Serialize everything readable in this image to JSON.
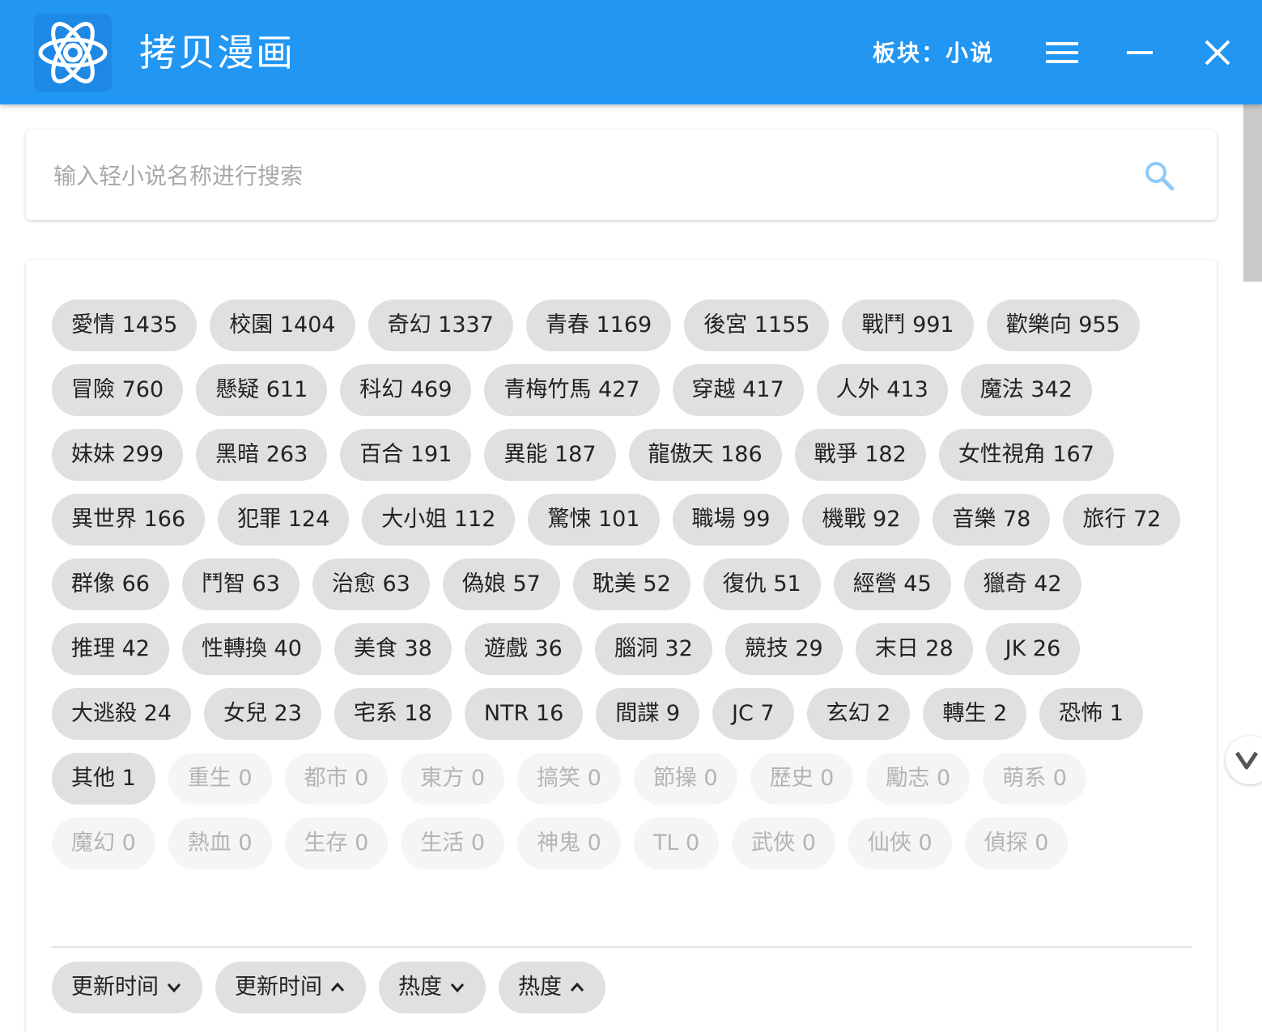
{
  "app": {
    "title": "拷贝漫画",
    "board_label": "板块：小说"
  },
  "colors": {
    "titlebar": "#2196f3",
    "chip_active_bg": "#e0e0e0",
    "chip_empty_bg": "#f5f5f5",
    "chip_empty_text": "#b4b4b4"
  },
  "icons": {
    "logo": "app-logo-icon",
    "menu": "hamburger-menu-icon",
    "minimize": "minimize-icon",
    "close": "close-icon",
    "search": "search-icon",
    "sort_desc": "chevron-down-icon",
    "sort_asc": "chevron-up-icon",
    "float": "scroll-down-icon"
  },
  "search": {
    "placeholder": "输入轻小说名称进行搜索",
    "value": ""
  },
  "tags": [
    {
      "label": "愛情 1435",
      "empty": false
    },
    {
      "label": "校園 1404",
      "empty": false
    },
    {
      "label": "奇幻 1337",
      "empty": false
    },
    {
      "label": "青春 1169",
      "empty": false
    },
    {
      "label": "後宮 1155",
      "empty": false
    },
    {
      "label": "戰鬥 991",
      "empty": false
    },
    {
      "label": "歡樂向 955",
      "empty": false
    },
    {
      "label": "冒險 760",
      "empty": false
    },
    {
      "label": "懸疑 611",
      "empty": false
    },
    {
      "label": "科幻 469",
      "empty": false
    },
    {
      "label": "青梅竹馬 427",
      "empty": false
    },
    {
      "label": "穿越 417",
      "empty": false
    },
    {
      "label": "人外 413",
      "empty": false
    },
    {
      "label": "魔法 342",
      "empty": false
    },
    {
      "label": "妹妹 299",
      "empty": false
    },
    {
      "label": "黑暗 263",
      "empty": false
    },
    {
      "label": "百合 191",
      "empty": false
    },
    {
      "label": "異能 187",
      "empty": false
    },
    {
      "label": "龍傲天 186",
      "empty": false
    },
    {
      "label": "戰爭 182",
      "empty": false
    },
    {
      "label": "女性視角 167",
      "empty": false
    },
    {
      "label": "異世界 166",
      "empty": false
    },
    {
      "label": "犯罪 124",
      "empty": false
    },
    {
      "label": "大小姐 112",
      "empty": false
    },
    {
      "label": "驚悚 101",
      "empty": false
    },
    {
      "label": "職場 99",
      "empty": false
    },
    {
      "label": "機戰 92",
      "empty": false
    },
    {
      "label": "音樂 78",
      "empty": false
    },
    {
      "label": "旅行 72",
      "empty": false
    },
    {
      "label": "群像 66",
      "empty": false
    },
    {
      "label": "鬥智 63",
      "empty": false
    },
    {
      "label": "治愈 63",
      "empty": false
    },
    {
      "label": "偽娘 57",
      "empty": false
    },
    {
      "label": "耽美 52",
      "empty": false
    },
    {
      "label": "復仇 51",
      "empty": false
    },
    {
      "label": "經營 45",
      "empty": false
    },
    {
      "label": "獵奇 42",
      "empty": false
    },
    {
      "label": "推理 42",
      "empty": false
    },
    {
      "label": "性轉換 40",
      "empty": false
    },
    {
      "label": "美食 38",
      "empty": false
    },
    {
      "label": "遊戲 36",
      "empty": false
    },
    {
      "label": "腦洞 32",
      "empty": false
    },
    {
      "label": "競技 29",
      "empty": false
    },
    {
      "label": "末日 28",
      "empty": false
    },
    {
      "label": "JK 26",
      "empty": false
    },
    {
      "label": "大逃殺 24",
      "empty": false
    },
    {
      "label": "女兒 23",
      "empty": false
    },
    {
      "label": "宅系 18",
      "empty": false
    },
    {
      "label": "NTR 16",
      "empty": false
    },
    {
      "label": "間諜 9",
      "empty": false
    },
    {
      "label": "JC 7",
      "empty": false
    },
    {
      "label": "玄幻 2",
      "empty": false
    },
    {
      "label": "轉生 2",
      "empty": false
    },
    {
      "label": "恐怖 1",
      "empty": false
    },
    {
      "label": "其他 1",
      "empty": false
    },
    {
      "label": "重生 0",
      "empty": true
    },
    {
      "label": "都市 0",
      "empty": true
    },
    {
      "label": "東方 0",
      "empty": true
    },
    {
      "label": "搞笑 0",
      "empty": true
    },
    {
      "label": "節操 0",
      "empty": true
    },
    {
      "label": "歷史 0",
      "empty": true
    },
    {
      "label": "勵志 0",
      "empty": true
    },
    {
      "label": "萌系 0",
      "empty": true
    },
    {
      "label": "魔幻 0",
      "empty": true
    },
    {
      "label": "熱血 0",
      "empty": true
    },
    {
      "label": "生存 0",
      "empty": true
    },
    {
      "label": "生活 0",
      "empty": true
    },
    {
      "label": "神鬼 0",
      "empty": true
    },
    {
      "label": "TL 0",
      "empty": true
    },
    {
      "label": "武俠 0",
      "empty": true
    },
    {
      "label": "仙俠 0",
      "empty": true
    },
    {
      "label": "偵探 0",
      "empty": true
    }
  ],
  "sort": [
    {
      "label": "更新时间",
      "direction": "down"
    },
    {
      "label": "更新时间",
      "direction": "up"
    },
    {
      "label": "热度",
      "direction": "down"
    },
    {
      "label": "热度",
      "direction": "up"
    }
  ]
}
